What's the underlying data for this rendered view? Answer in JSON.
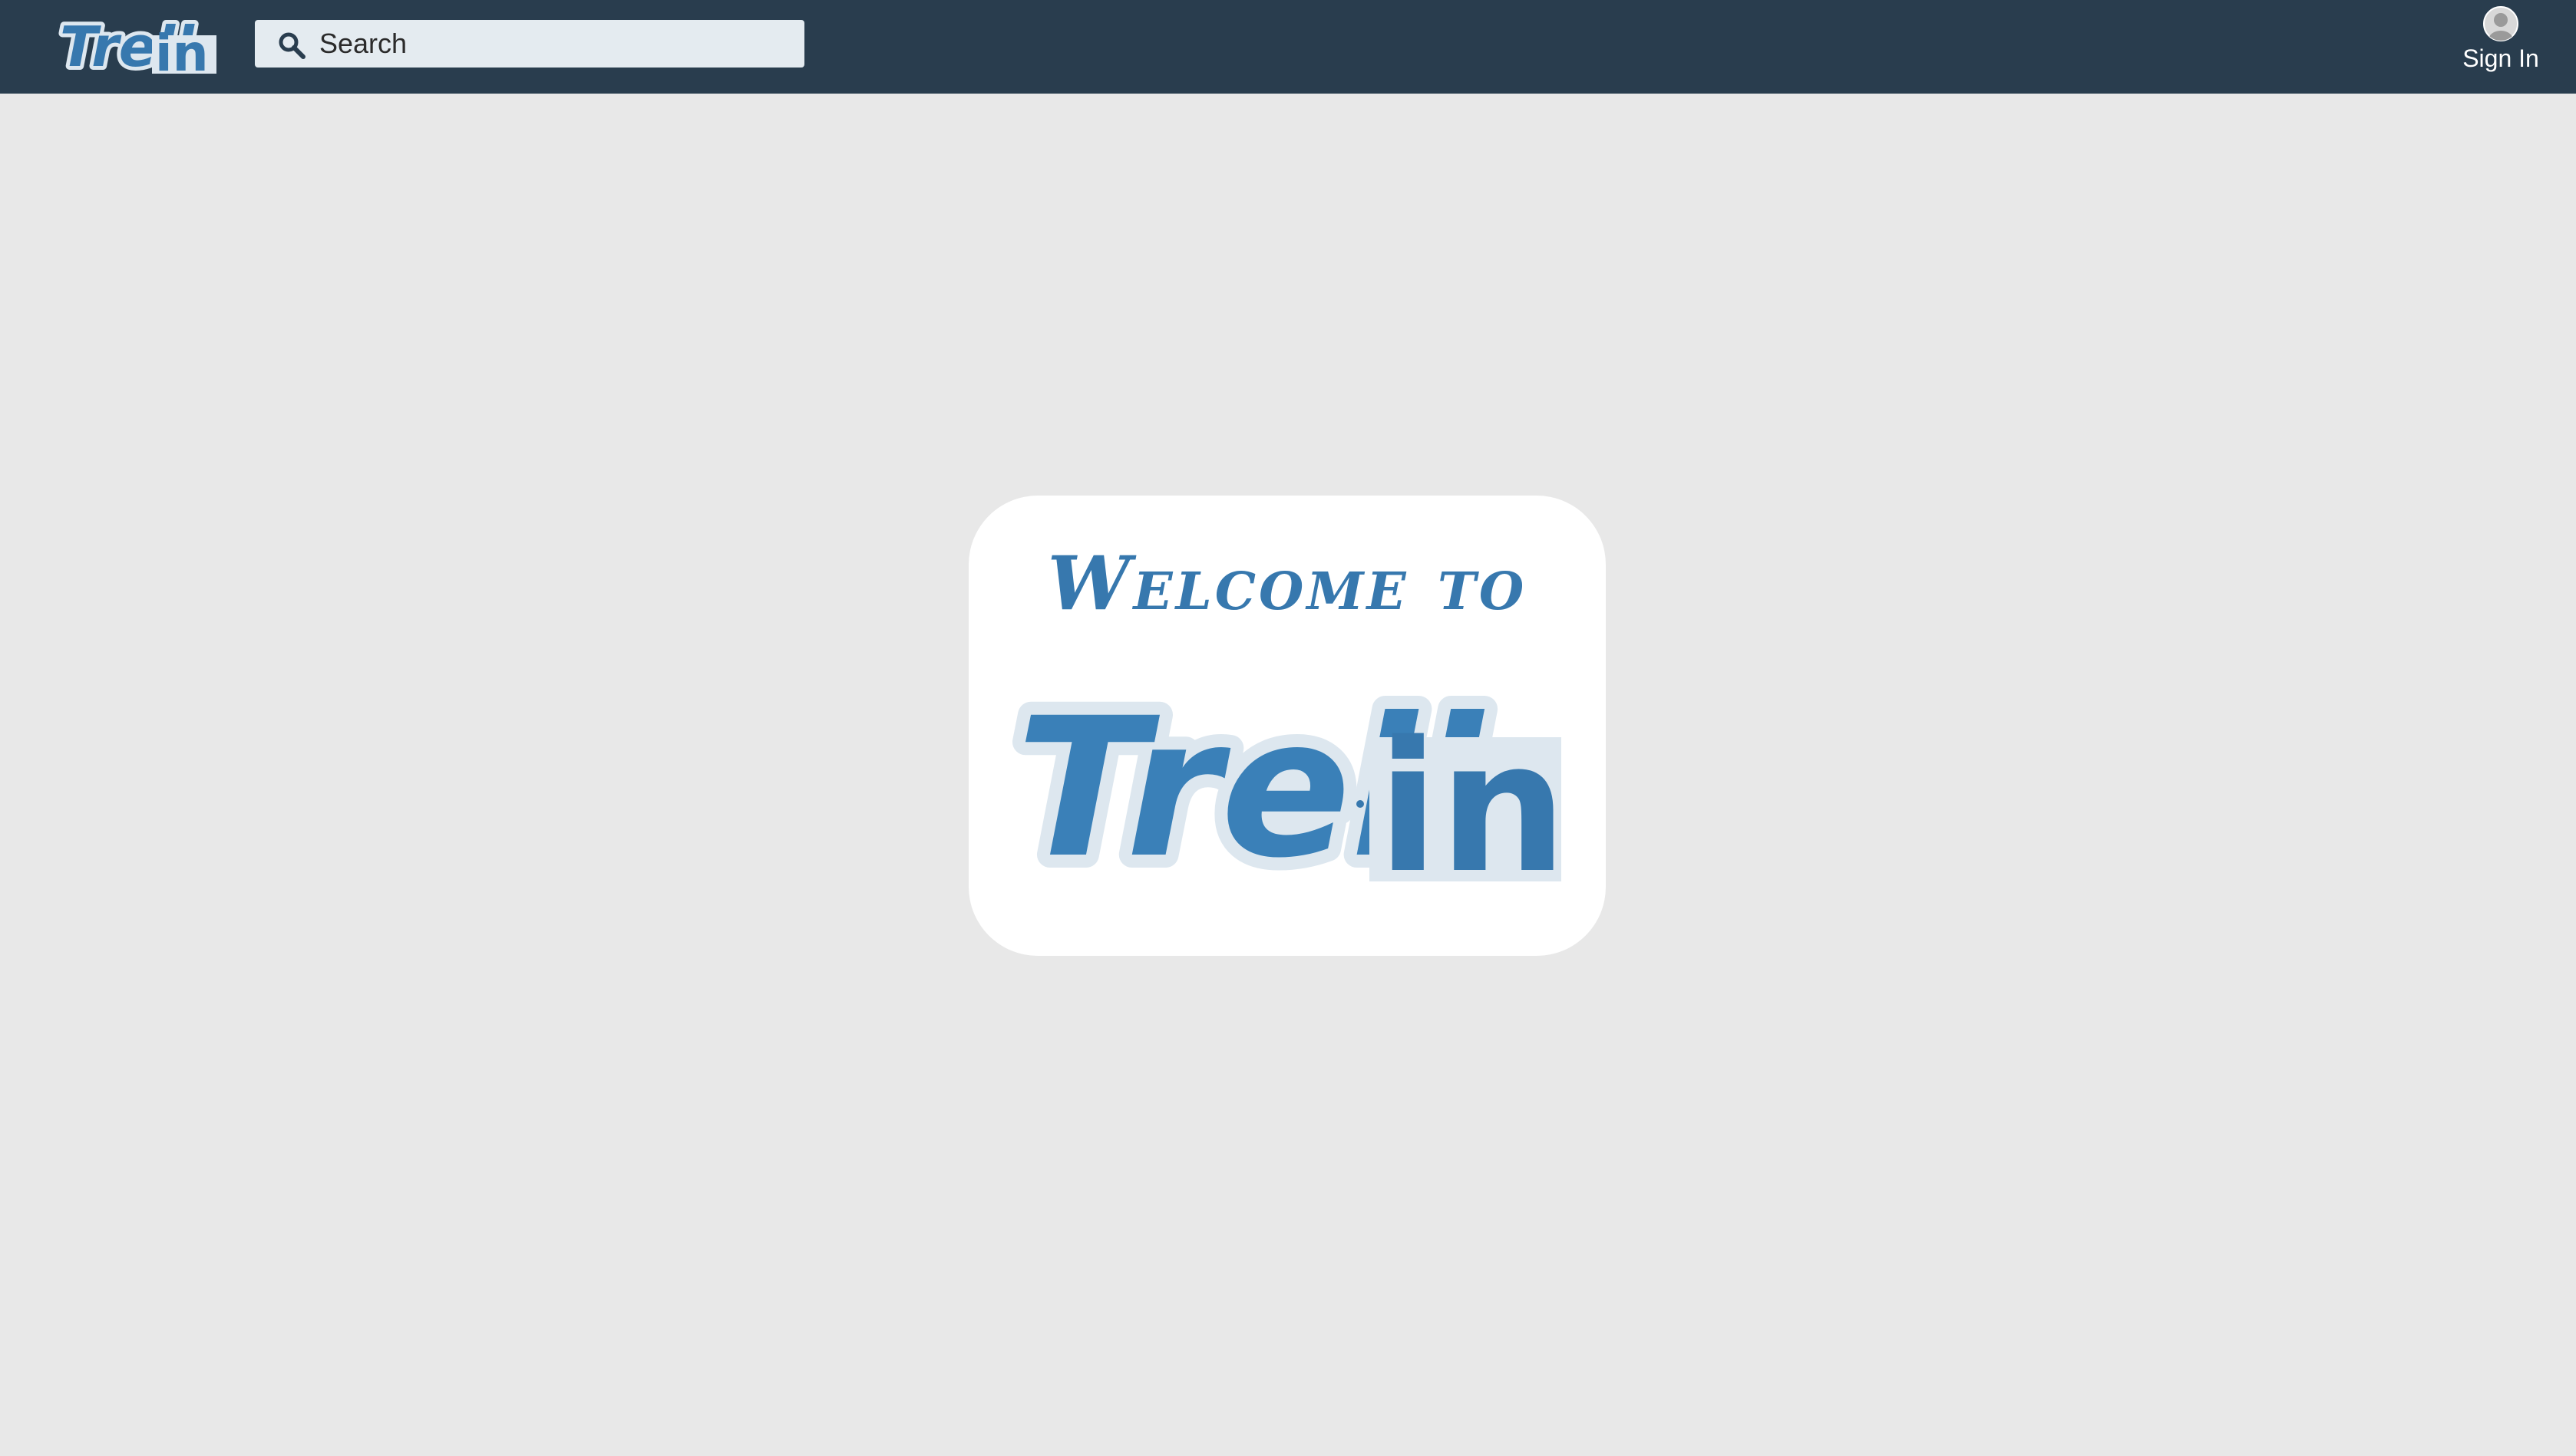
{
  "app": {
    "brand": "Trell in"
  },
  "header": {
    "search": {
      "placeholder": "Search",
      "value": ""
    },
    "signin_label": "Sign In",
    "icons": {
      "search": "search-icon",
      "avatar": "user-avatar-icon"
    }
  },
  "welcome": {
    "heading": "Welcome to",
    "logo_text": "Trell in"
  },
  "colors": {
    "topbar": "#293d4e",
    "background": "#e8e8e8",
    "brand_blue": "#3778ae",
    "logo_outline": "#dde7ef"
  }
}
